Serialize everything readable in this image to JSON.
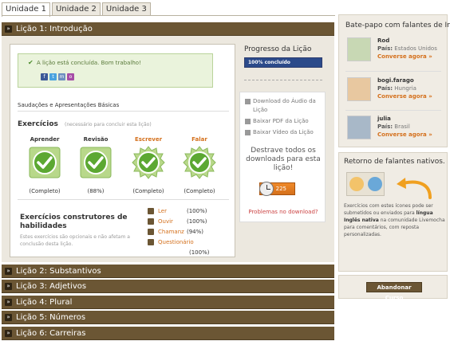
{
  "tabs": [
    {
      "label": "Unidade 1",
      "active": true
    },
    {
      "label": "Unidade 2",
      "active": false
    },
    {
      "label": "Unidade 3",
      "active": false
    }
  ],
  "lessons": [
    {
      "label": "Lição 1: Introdução",
      "expanded": true
    },
    {
      "label": "Lição 2: Substantivos"
    },
    {
      "label": "Lição 3: Adjetivos"
    },
    {
      "label": "Lição 4: Plural"
    },
    {
      "label": "Lição 5: Números"
    },
    {
      "label": "Lição 6: Carreiras"
    }
  ],
  "lesson1": {
    "success_message": "A lição está concluída. Bom trabalho!",
    "share_icons": [
      "facebook-icon",
      "twitter-icon",
      "myspace-icon",
      "other-share-icon"
    ],
    "title": "Saudações e Apresentações Básicas",
    "exercises_title": "Exercícios",
    "exercises_subtitle": "(necessário para concluir esta lição)",
    "exercises": [
      {
        "name": "Aprender",
        "status": "(Completo)",
        "color": "#333333"
      },
      {
        "name": "Revisão",
        "status": "(88%)",
        "color": "#333333"
      },
      {
        "name": "Escrever",
        "status": "(Completo)",
        "color": "#d4701c"
      },
      {
        "name": "Falar",
        "status": "(Completo)",
        "color": "#d4701c"
      }
    ],
    "builders_title": "Exercícios construtores de habilidades",
    "builders_desc": "Estes exercícios são opcionais e não afetam a conclusão desta lição.",
    "builders": [
      {
        "label": "Ler",
        "pct": "(100%)"
      },
      {
        "label": "Ouvir",
        "pct": "(100%)"
      },
      {
        "label": "Chamanz",
        "pct": "(94%)"
      },
      {
        "label": "Questionário",
        "pct": "(100%)"
      }
    ]
  },
  "progress": {
    "label": "Progresso da Lição",
    "value_text": "100% concluído",
    "value": 1.0
  },
  "downloads": {
    "items": [
      {
        "label": "Download do Áudio da Lição"
      },
      {
        "label": "Baixar PDF da Lição"
      },
      {
        "label": "Baixar Vídeo da Lição"
      }
    ],
    "promo": "Destrave todos os downloads para esta lição!",
    "price": "225",
    "problems_link": "Problemas no download?"
  },
  "chat": {
    "title": "Bate-papo com falantes de Inglês",
    "country_label": "País:",
    "link_label": "Converse agora »",
    "users": [
      {
        "name": "Rod",
        "country": "Estados Unidos"
      },
      {
        "name": "bogi.farago",
        "country": "Hungria"
      },
      {
        "name": "julia",
        "country": "Brasil"
      }
    ]
  },
  "feedback": {
    "title": "Retorno de falantes nativos.",
    "text_part1": "Exercícios com estes ícones pode ser submetidos ou enviados para ",
    "text_bold1": "língua Inglês nativa",
    "text_part2": " na comunidade Livemocha para comentários, com reposta personalizadas."
  },
  "abandon_label": "Abandonar Curso",
  "colors": {
    "header_brown": "#6b5634",
    "accent_orange": "#d4701c",
    "progress_blue": "#2b4a8a",
    "check_green": "#5ca832"
  }
}
